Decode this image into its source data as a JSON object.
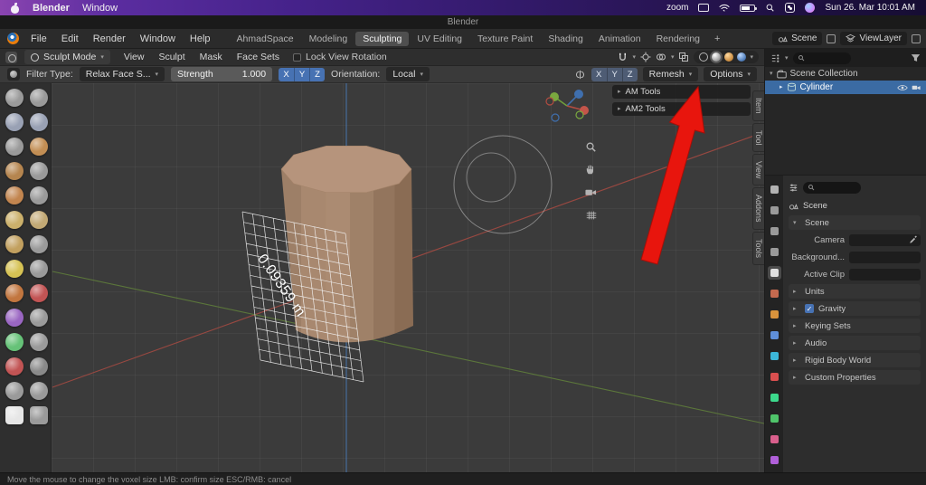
{
  "menubar": {
    "app_name": "Blender",
    "window_menu": "Window",
    "zoom_label": "zoom",
    "datetime": "Sun 26. Mar 10:01 AM"
  },
  "titlebar": {
    "title": "Blender"
  },
  "topbar": {
    "menus": [
      "File",
      "Edit",
      "Render",
      "Window",
      "Help"
    ],
    "workspaces": [
      "AhmadSpace",
      "Modeling",
      "Sculpting",
      "UV Editing",
      "Texture Paint",
      "Shading",
      "Animation",
      "Rendering"
    ],
    "active_workspace": "Sculpting",
    "add_workspace_label": "+",
    "scene_label": "Scene",
    "viewlayer_label": "ViewLayer"
  },
  "viewport_header": {
    "mode": "Sculpt Mode",
    "menus": [
      "View",
      "Sculpt",
      "Mask",
      "Face Sets"
    ],
    "lock_view_rotation": "Lock View Rotation"
  },
  "tool_settings": {
    "filter_type_label": "Filter Type:",
    "filter_type_value": "Relax Face S...",
    "strength_label": "Strength",
    "strength_value": "1.000",
    "filter_axes": [
      "X",
      "Y",
      "Z"
    ],
    "orientation_label": "Orientation:",
    "orientation_value": "Local",
    "symmetry_axes": [
      "X",
      "Y",
      "Z"
    ],
    "remesh_label": "Remesh",
    "options_label": "Options"
  },
  "viewport": {
    "panels": [
      {
        "label": "AM Tools"
      },
      {
        "label": "AM2 Tools"
      }
    ],
    "side_tabs": [
      "Item",
      "Tool",
      "View",
      "Addons",
      "Tools"
    ],
    "voxel_size": "0.09359 m"
  },
  "outliner": {
    "collection_label": "Scene Collection",
    "object_label": "Cylinder"
  },
  "properties": {
    "breadcrumb": "Scene",
    "rows": [
      {
        "kind": "open",
        "label": "Scene"
      },
      {
        "kind": "field",
        "label": "Camera",
        "eyedropper": true
      },
      {
        "kind": "field",
        "label": "Background...",
        "eyedropper": false
      },
      {
        "kind": "field",
        "label": "Active Clip",
        "eyedropper": false
      },
      {
        "kind": "collapsed",
        "label": "Units"
      },
      {
        "kind": "collapsed",
        "label": "Gravity",
        "checkbox": true
      },
      {
        "kind": "collapsed",
        "label": "Keying Sets"
      },
      {
        "kind": "collapsed",
        "label": "Audio"
      },
      {
        "kind": "collapsed",
        "label": "Rigid Body World"
      },
      {
        "kind": "collapsed",
        "label": "Custom Properties"
      }
    ],
    "tabs": [
      {
        "name": "tool",
        "color": "#b2b2b2",
        "active": false
      },
      {
        "name": "render",
        "color": "#9a9a9a",
        "active": false
      },
      {
        "name": "output",
        "color": "#9a9a9a",
        "active": false
      },
      {
        "name": "view-layer",
        "color": "#9a9a9a",
        "active": false
      },
      {
        "name": "scene",
        "color": "#e0e0e0",
        "active": true
      },
      {
        "name": "world",
        "color": "#c46a4f",
        "active": false
      },
      {
        "name": "object",
        "color": "#d9933c",
        "active": false
      },
      {
        "name": "modifiers",
        "color": "#5f8fd9",
        "active": false
      },
      {
        "name": "particles",
        "color": "#3cb7d9",
        "active": false
      },
      {
        "name": "physics",
        "color": "#d94f4f",
        "active": false
      },
      {
        "name": "constraints",
        "color": "#3cd98c",
        "active": false
      },
      {
        "name": "object-data",
        "color": "#4fc46a",
        "active": false
      },
      {
        "name": "material",
        "color": "#d95f8c",
        "active": false
      },
      {
        "name": "texture",
        "color": "#b05fd9",
        "active": false
      }
    ]
  },
  "toolbar": {
    "brushes": [
      {
        "color": "#9a9a9a",
        "shape": "circle"
      },
      {
        "color": "#9a9a9a",
        "shape": "circle"
      },
      {
        "color": "#99a1b4",
        "shape": "circle"
      },
      {
        "color": "#99a1b4",
        "shape": "circle"
      },
      {
        "color": "#9a9a9a",
        "shape": "circle"
      },
      {
        "color": "#c28e54",
        "shape": "circle"
      },
      {
        "color": "#b5854f",
        "shape": "circle"
      },
      {
        "color": "#9a9a9a",
        "shape": "circle"
      },
      {
        "color": "#c2854f",
        "shape": "circle"
      },
      {
        "color": "#9a9a9a",
        "shape": "circle"
      },
      {
        "color": "#cbb06b",
        "shape": "circle"
      },
      {
        "color": "#c2a975",
        "shape": "circle"
      },
      {
        "color": "#c2a05f",
        "shape": "circle"
      },
      {
        "color": "#9a9a9a",
        "shape": "circle"
      },
      {
        "color": "#d6c254",
        "shape": "circle"
      },
      {
        "color": "#9a9a9a",
        "shape": "circle"
      },
      {
        "color": "#c2763f",
        "shape": "circle"
      },
      {
        "color": "#c25454",
        "shape": "circle"
      },
      {
        "color": "#9a66c2",
        "shape": "circle"
      },
      {
        "color": "#9a9a9a",
        "shape": "circle"
      },
      {
        "color": "#66c278",
        "shape": "circle"
      },
      {
        "color": "#9a9a9a",
        "shape": "circle"
      },
      {
        "color": "#c25454",
        "shape": "circle"
      },
      {
        "color": "#8a8a8a",
        "shape": "circle"
      },
      {
        "color": "#9a9a9a",
        "shape": "circle"
      },
      {
        "color": "#9a9a9a",
        "shape": "circle"
      },
      {
        "color": "#e6e6e6",
        "shape": "square"
      },
      {
        "color": "#9a9a9a",
        "shape": "square"
      }
    ]
  },
  "statusbar": {
    "hint": "Move the mouse to change the voxel size    LMB: confirm size    ESC/RMB: cancel"
  },
  "colors": {
    "accent_blue": "#4772b3",
    "selection_blue": "#3b6ba3",
    "arrow_red": "#e8150d"
  }
}
